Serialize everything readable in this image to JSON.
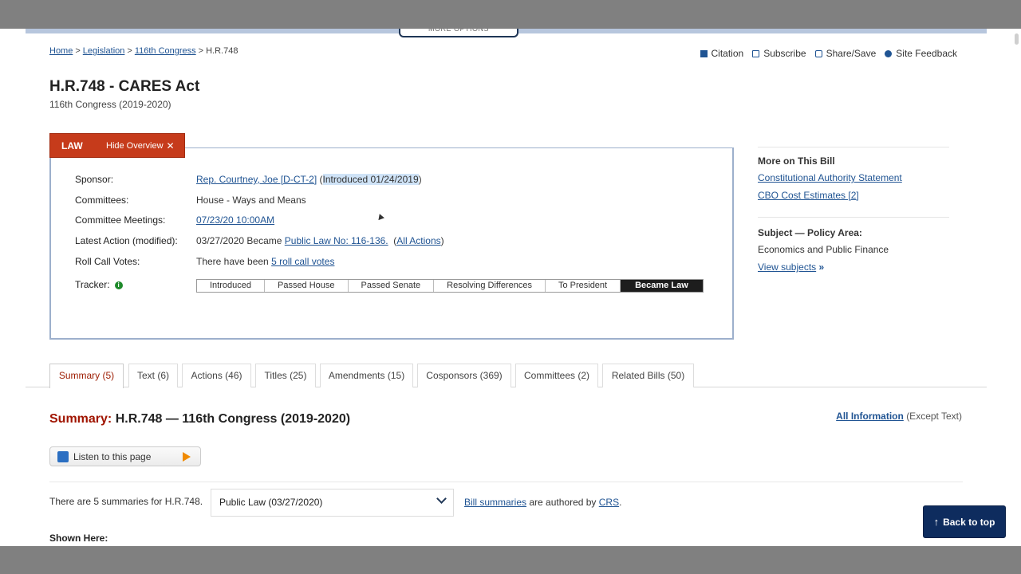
{
  "header": {
    "more_options": "MORE OPTIONS"
  },
  "breadcrumb": {
    "items": [
      "Home",
      "Legislation",
      "116th Congress"
    ],
    "current": "H.R.748",
    "separator": ">"
  },
  "utility_links": [
    {
      "label": "Citation",
      "icon": "citation-icon"
    },
    {
      "label": "Subscribe",
      "icon": "subscribe-icon"
    },
    {
      "label": "Share/Save",
      "icon": "share-icon"
    },
    {
      "label": "Site Feedback",
      "icon": "feedback-icon"
    }
  ],
  "bill": {
    "title": "H.R.748 - CARES Act",
    "congress": "116th Congress (2019-2020)"
  },
  "law_tab": {
    "status": "LAW",
    "hide_overview": "Hide Overview",
    "close_glyph": "✕"
  },
  "overview": {
    "sponsor_label": "Sponsor:",
    "sponsor_name": "Rep. Courtney, Joe [D-CT-2]",
    "sponsor_introduced": "Introduced 01/24/2019",
    "committees_label": "Committees:",
    "committees_value": "House - Ways and Means",
    "meetings_label": "Committee Meetings:",
    "meetings_value": "07/23/20 10:00AM",
    "latest_label": "Latest Action (modified):",
    "latest_prefix": "03/27/2020 Became",
    "latest_link": "Public Law No: 116-136.",
    "all_actions": "All Actions",
    "rollcall_label": "Roll Call Votes:",
    "rollcall_prefix": "There have been",
    "rollcall_link": "5 roll call votes",
    "tracker_label": "Tracker:",
    "tracker_info": "i",
    "tracker_steps": [
      "Introduced",
      "Passed House",
      "Passed Senate",
      "Resolving Differences",
      "To President",
      "Became Law"
    ]
  },
  "sidebar": {
    "more_heading": "More on This Bill",
    "more_links": [
      "Constitutional Authority Statement",
      "CBO Cost Estimates [2]"
    ],
    "subject_heading": "Subject — Policy Area:",
    "subject_value": "Economics and Public Finance",
    "view_subjects": "View subjects",
    "view_subjects_glyph": "»"
  },
  "tabs": [
    {
      "label": "Summary (5)",
      "active": true
    },
    {
      "label": "Text (6)"
    },
    {
      "label": "Actions (46)"
    },
    {
      "label": "Titles (25)"
    },
    {
      "label": "Amendments (15)"
    },
    {
      "label": "Cosponsors (369)"
    },
    {
      "label": "Committees (2)"
    },
    {
      "label": "Related Bills (50)"
    }
  ],
  "summary": {
    "label": "Summary:",
    "title": "H.R.748 — 116th Congress (2019-2020)",
    "all_info": "All Information",
    "all_info_suffix": "(Except Text)",
    "listen": "Listen to this page",
    "count_text": "There are 5 summaries for H.R.748.",
    "selected_version": "Public Law (03/27/2020)",
    "bill_summaries": "Bill summaries",
    "authored_by": "are authored by",
    "crs": "CRS",
    "period": ".",
    "shown_here": "Shown Here:"
  },
  "back_to_top": {
    "label": "Back to top",
    "arrow": "↑"
  },
  "colors": {
    "law_red": "#c63b1b",
    "link_blue": "#205493",
    "active_tab": "#9c1b00",
    "back_top_bg": "#0e2c5e"
  }
}
